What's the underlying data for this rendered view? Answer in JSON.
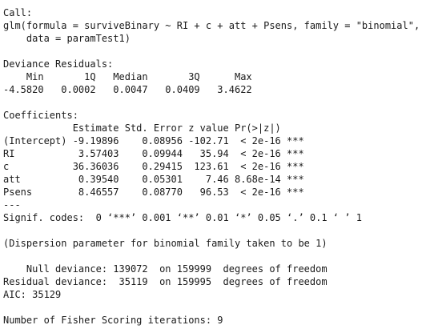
{
  "output": {
    "call_header": "Call:",
    "call_line1": "glm(formula = surviveBinary ~ RI + c + att + Psens, family = \"binomial\",",
    "call_line2": "    data = paramTest1)",
    "deviance_header": "Deviance Residuals:",
    "deviance_cols": "    Min       1Q   Median       3Q      Max",
    "deviance_vals": "-4.5820   0.0002   0.0047   0.0409   3.4622",
    "coef_header": "Coefficients:",
    "coef_cols": "            Estimate Std. Error z value Pr(>|z|)",
    "coef_rows": [
      "(Intercept) -9.19896    0.08956 -102.71  < 2e-16 ***",
      "RI           3.57403    0.09944   35.94  < 2e-16 ***",
      "c           36.36036    0.29415  123.61  < 2e-16 ***",
      "att          0.39540    0.05301    7.46 8.68e-14 ***",
      "Psens        8.46557    0.08770   96.53  < 2e-16 ***"
    ],
    "separator": "---",
    "signif_codes": "Signif. codes:  0 ‘***’ 0.001 ‘**’ 0.01 ‘*’ 0.05 ‘.’ 0.1 ‘ ’ 1",
    "dispersion": "(Dispersion parameter for binomial family taken to be 1)",
    "null_deviance": "    Null deviance: 139072  on 159999  degrees of freedom",
    "residual_deviance": "Residual deviance:  35119  on 159995  degrees of freedom",
    "aic": "AIC: 35129",
    "fisher": "Number of Fisher Scoring iterations: 9"
  }
}
